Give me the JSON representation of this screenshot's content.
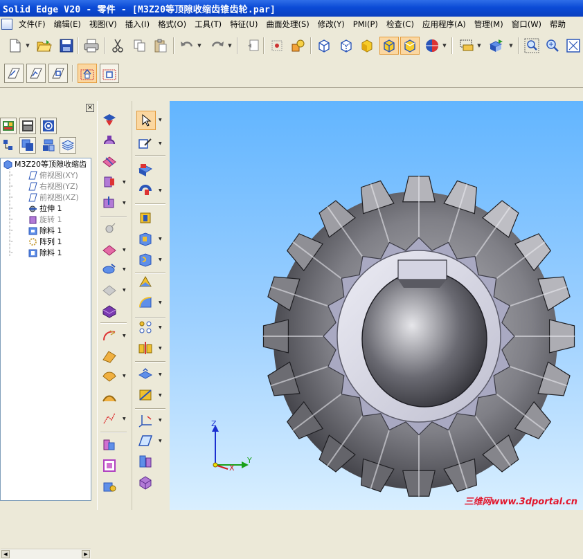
{
  "window": {
    "title": "Solid Edge V20 - 零件 - [M3Z20等顶隙收缩齿锥齿轮.par]"
  },
  "menu": {
    "items": [
      "文件(F)",
      "编辑(E)",
      "视图(V)",
      "插入(I)",
      "格式(O)",
      "工具(T)",
      "特征(U)",
      "曲面处理(S)",
      "修改(Y)",
      "PMI(P)",
      "检查(C)",
      "应用程序(A)",
      "管理(M)",
      "窗口(W)",
      "帮助"
    ]
  },
  "tree": {
    "root": "M3Z20等顶隙收缩齿",
    "items": [
      {
        "label": "俯视图(XY)",
        "icon": "plane-icon",
        "dim": true
      },
      {
        "label": "右视图(YZ)",
        "icon": "plane-icon",
        "dim": true
      },
      {
        "label": "前视图(XZ)",
        "icon": "plane-icon",
        "dim": true
      },
      {
        "label": "拉伸 1",
        "icon": "extrude-icon",
        "dim": false
      },
      {
        "label": "旋转 1",
        "icon": "revolve-icon",
        "dim": true
      },
      {
        "label": "除料 1",
        "icon": "cutout-icon",
        "dim": false
      },
      {
        "label": "阵列 1",
        "icon": "pattern-icon",
        "dim": false
      },
      {
        "label": "除料 1",
        "icon": "cutout-icon",
        "dim": false
      }
    ]
  },
  "triad": {
    "z": "Z",
    "y": "Y",
    "x": "X"
  },
  "watermark": "三维网www.3dportal.cn",
  "colors": {
    "title_bar": "#0b4bd6",
    "viewport_top": "#62b5ff",
    "active_button": "#fbd7a0",
    "watermark": "#e2182e"
  }
}
